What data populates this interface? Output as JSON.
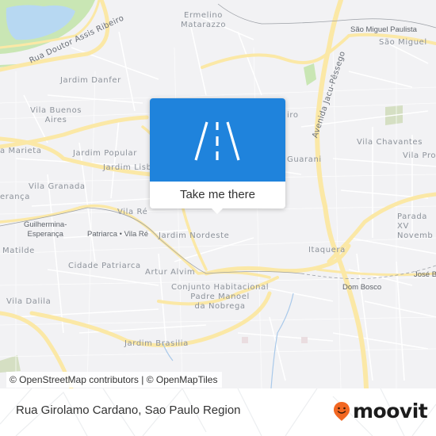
{
  "map": {
    "colors": {
      "background": "#f2f2f4",
      "major_road": "#fbe8a6",
      "park": "#c9e6b4",
      "water": "#b7d8f2",
      "popup_header": "#1f83dc"
    },
    "neighborhood_labels": [
      "Ermelino\nMatarazzo",
      "Jardim Danfer",
      "Vila Buenos\nAires",
      "a Marieta",
      "Jardim Popular",
      "Jardim Lisb",
      "Vila Granada",
      "erança",
      "Vila Ré",
      "Jardim Nordeste",
      "Matilde",
      "Cidade Patriarca",
      "Artur Alvim",
      "Conjunto Habitacional\nPadre Manoel\nda Nobrega",
      "Vila Dalila",
      "Jardim Brasilia",
      "São Miguel",
      "Vila Chavantes",
      "Vila Pro",
      "Parada XV\nNovemb",
      "Itaquera",
      "Guarani",
      "iro"
    ],
    "station_labels": [
      "São Miguel Paulista",
      "Guilhermina-\nEsperança",
      "Patriarca • Vila Ré",
      "Dom Bosco",
      "José Bo"
    ],
    "road_labels": [
      "Rua Doutor Assis Ribeiro",
      "Avenida Jacu-Pêssego"
    ]
  },
  "popup": {
    "icon": "road-icon",
    "action_label": "Take me there"
  },
  "attribution": "© OpenStreetMap contributors | © OpenMapTiles",
  "footer": {
    "location_title": "Rua Girolamo Cardano, Sao Paulo Region",
    "brand": "moovit",
    "brand_color": "#f26722"
  }
}
